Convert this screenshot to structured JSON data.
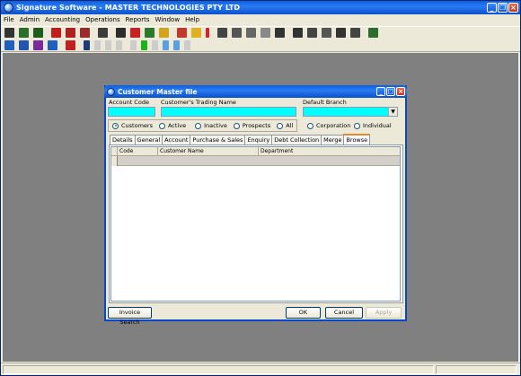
{
  "app": {
    "title": "Signature Software - MASTER TECHNOLOGIES PTY LTD"
  },
  "menu": [
    "File",
    "Admin",
    "Accounting",
    "Operations",
    "Reports",
    "Window",
    "Help"
  ],
  "toolbar1": [
    "person-icon",
    "book-icon",
    "calculator-icon",
    "document-icon",
    "arrow-icon",
    "flag-icon",
    "tree-icon",
    "truck-icon",
    "hat-icon",
    "bottle-icon",
    "phone-icon",
    "ie-icon",
    "wand-icon",
    "alert-icon",
    "chart-icon",
    "lock-icon",
    "gear-icon",
    "cursor-icon",
    "star-icon",
    "eraser-icon",
    "check-icon",
    "printer-icon",
    "network-icon",
    "export-icon",
    "table-icon"
  ],
  "toolbar2": [
    "warning-icon",
    "home-icon",
    "print-icon",
    "diamond-icon",
    "alert-icon",
    "first-icon",
    "prev-icon",
    "next-icon",
    "last-icon",
    "edit-icon",
    "add-icon",
    "remove-icon",
    "check-icon",
    "cancel-icon",
    "refresh-icon"
  ],
  "dialog": {
    "title": "Customer Master file",
    "account_code_label": "Account Code",
    "trading_name_label": "Customer's Trading Name",
    "default_branch_label": "Default Branch",
    "account_code_value": "",
    "trading_name_value": "",
    "branch_value": "",
    "filter_options": [
      "Customers",
      "Active",
      "Inactive",
      "Prospects",
      "All"
    ],
    "filter_selected": "Customers",
    "type_options": [
      "Corporation",
      "Individual"
    ],
    "tabs": [
      "Details",
      "General",
      "Account",
      "Purchase & Sales",
      "Enquiry",
      "Debt Collection",
      "Merge",
      "Browse"
    ],
    "active_tab": "Browse",
    "grid_columns": [
      "Code",
      "Customer Name",
      "Department"
    ],
    "buttons": {
      "invoice_search": "Invoice Search",
      "ok": "OK",
      "cancel": "Cancel",
      "apply": "Apply"
    }
  },
  "colors": {
    "accent": "#00ffff",
    "title": "#0a5fe0"
  }
}
